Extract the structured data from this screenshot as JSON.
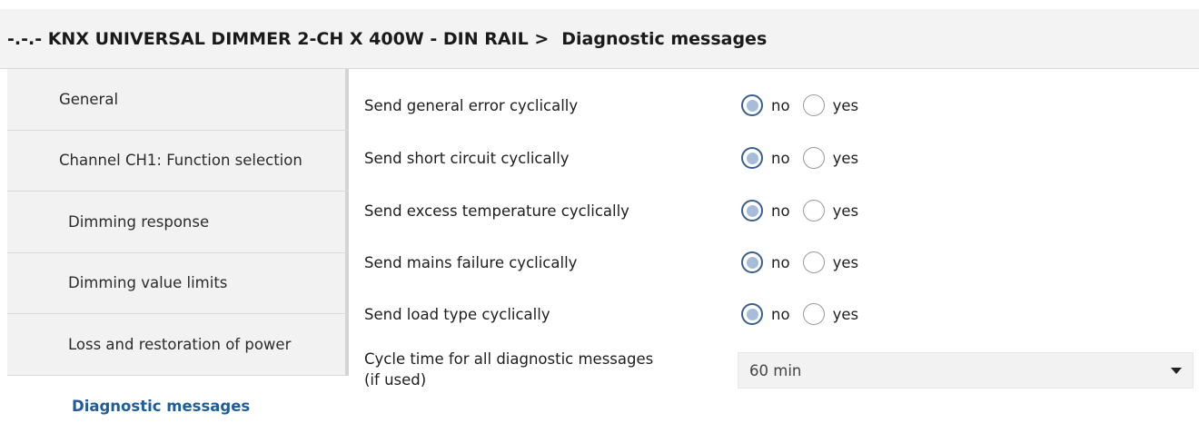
{
  "header": {
    "device": "-.-.- KNX UNIVERSAL DIMMER 2-CH X 400W - DIN RAIL >",
    "page": "Diagnostic messages"
  },
  "sidebar": {
    "items": [
      {
        "label": "General"
      },
      {
        "label": "Channel CH1: Function selection"
      },
      {
        "label": "Dimming response"
      },
      {
        "label": "Dimming value limits"
      },
      {
        "label": "Loss and restoration of power"
      },
      {
        "label": "Diagnostic messages",
        "active": true
      }
    ]
  },
  "settings": {
    "rows": [
      {
        "label": "Send general error cyclically",
        "options": [
          "no",
          "yes"
        ],
        "selected": "no"
      },
      {
        "label": "Send short circuit cyclically",
        "options": [
          "no",
          "yes"
        ],
        "selected": "no"
      },
      {
        "label": "Send excess temperature cyclically",
        "options": [
          "no",
          "yes"
        ],
        "selected": "no"
      },
      {
        "label": "Send mains failure cyclically",
        "options": [
          "no",
          "yes"
        ],
        "selected": "no"
      },
      {
        "label": "Send load type cyclically",
        "options": [
          "no",
          "yes"
        ],
        "selected": "no"
      }
    ],
    "cycle_time": {
      "label_line1": "Cycle time for all diagnostic messages",
      "label_line2": "(if used)",
      "value": "60 min"
    }
  },
  "colors": {
    "accent": "#1e5d9a",
    "radio_border": "#3a5f8f",
    "radio_fill": "#a7bcd9",
    "header_bg": "#f3f3f3",
    "sidebar_bg": "#f2f2f2"
  }
}
